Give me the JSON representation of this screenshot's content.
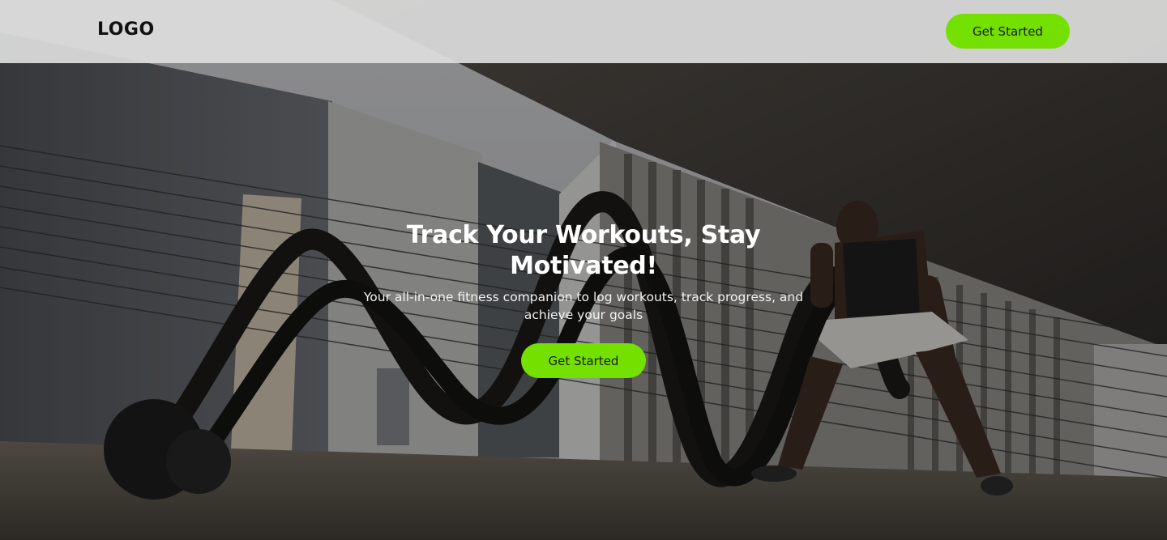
{
  "header": {
    "logo_text": "LOGO",
    "cta_label": "Get Started"
  },
  "hero": {
    "title": "Track Your Workouts, Stay Motivated!",
    "subtitle": "Your all-in-one fitness companion to log workouts, track progress, and achieve your goals",
    "cta_label": "Get Started",
    "background_image": "athlete-battle-ropes-photo"
  },
  "colors": {
    "accent": "#74e000",
    "header_bg": "#dddddd",
    "text_light": "#ffffff",
    "text_dark": "#111111"
  }
}
